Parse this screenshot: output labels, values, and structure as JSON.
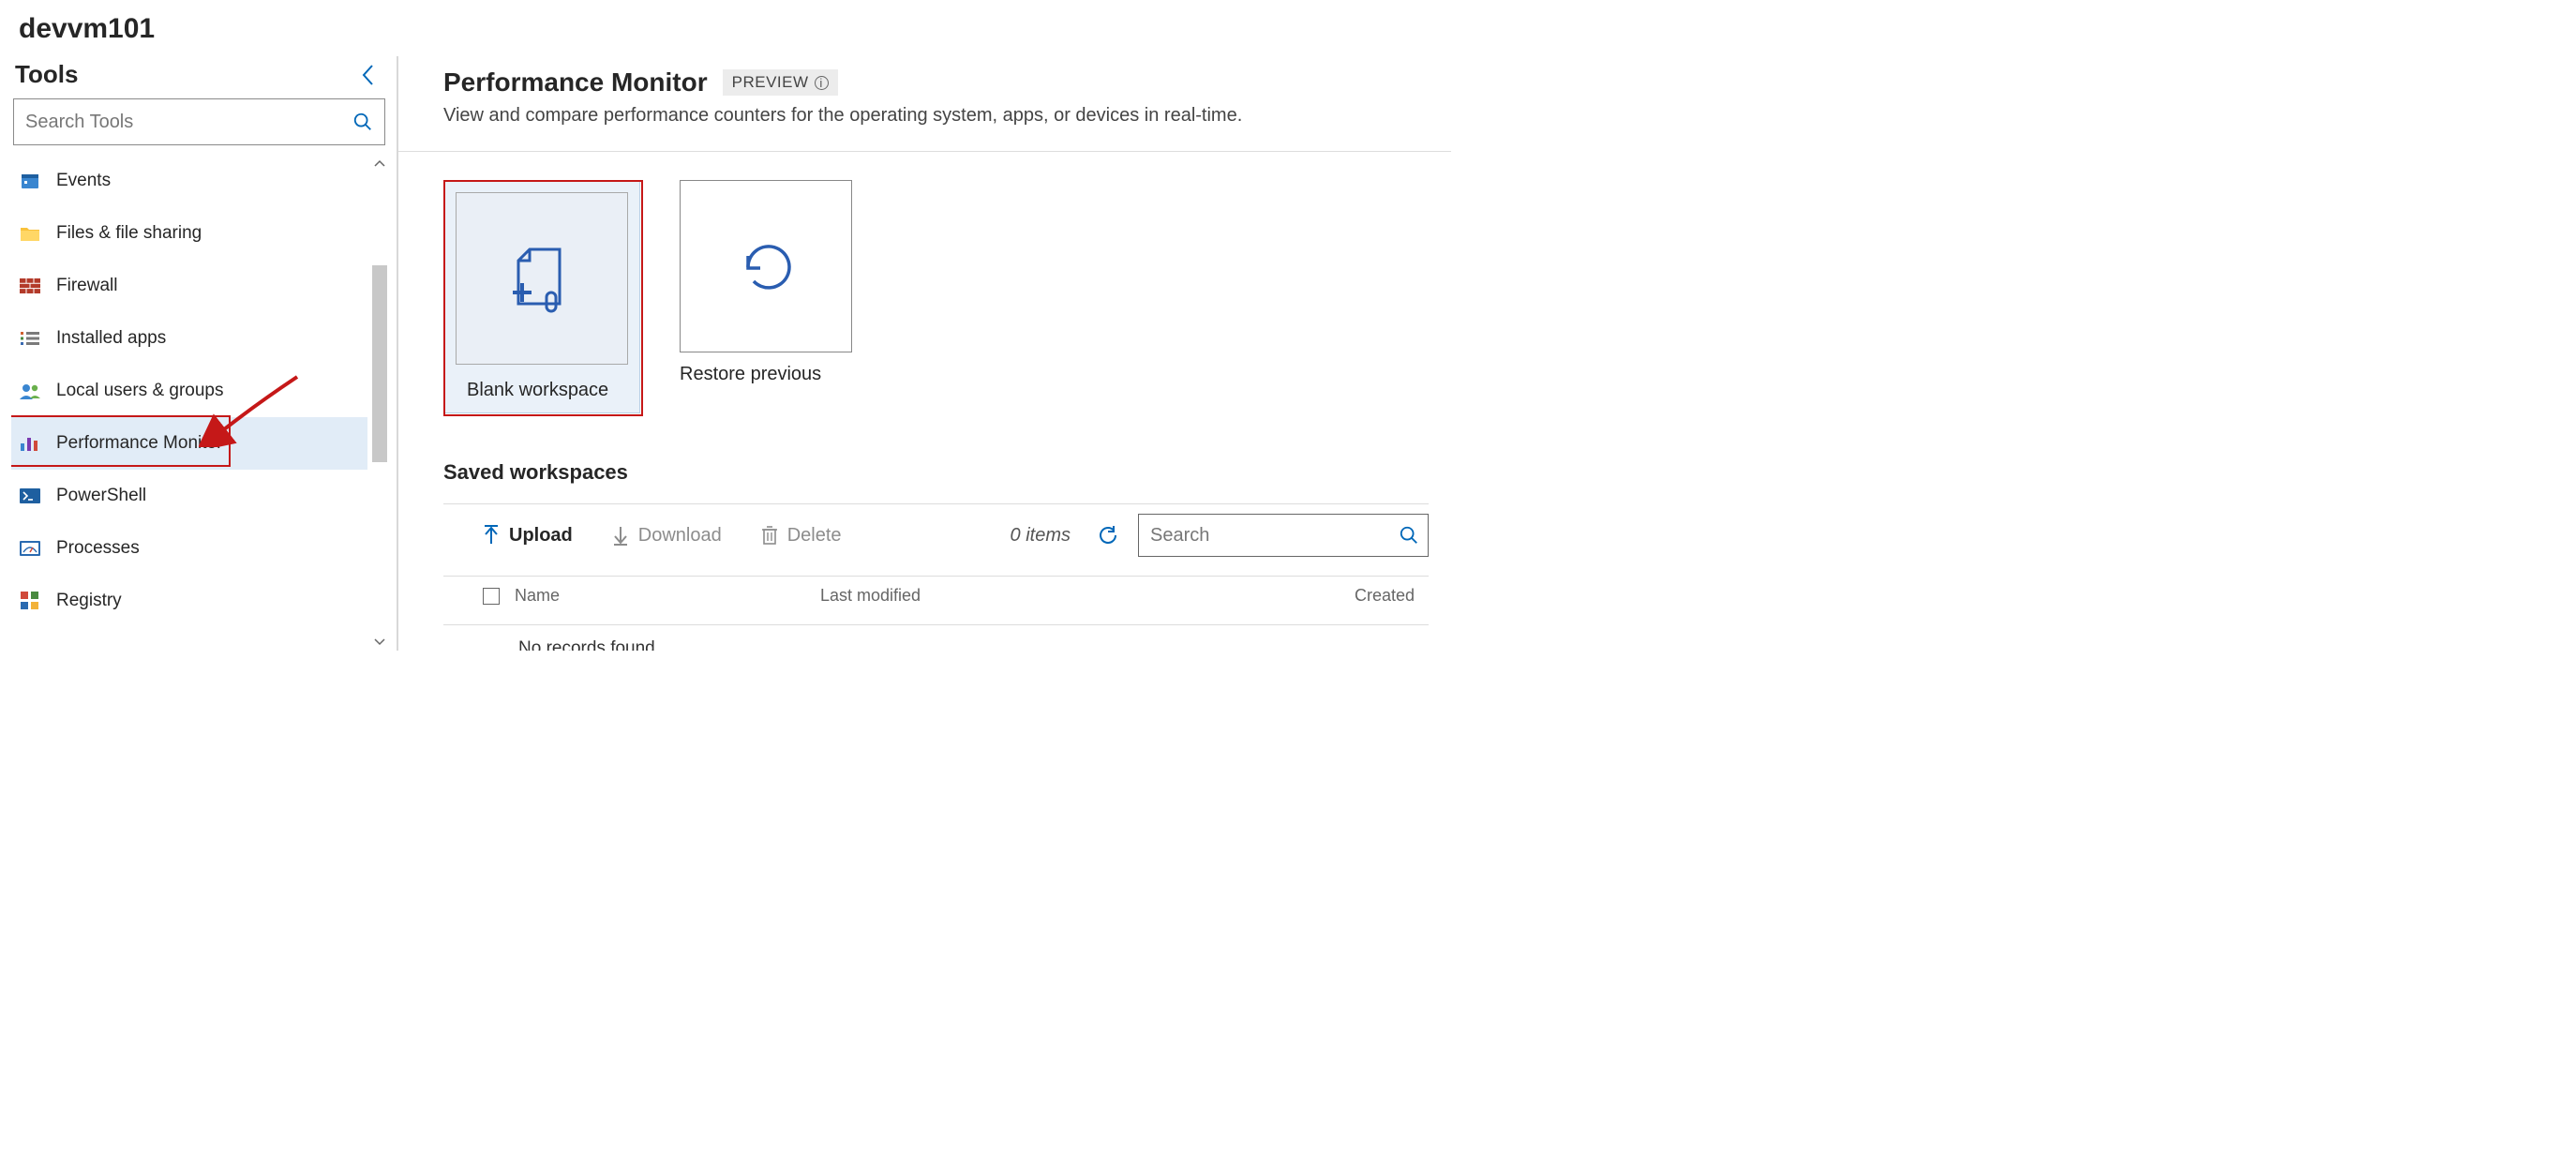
{
  "page_title": "devvm101",
  "sidebar": {
    "heading": "Tools",
    "search_placeholder": "Search Tools",
    "items": [
      {
        "label": "Events"
      },
      {
        "label": "Files & file sharing"
      },
      {
        "label": "Firewall"
      },
      {
        "label": "Installed apps"
      },
      {
        "label": "Local users & groups"
      },
      {
        "label": "Performance Monitor"
      },
      {
        "label": "PowerShell"
      },
      {
        "label": "Processes"
      },
      {
        "label": "Registry"
      }
    ],
    "active_index": 5
  },
  "main": {
    "title": "Performance Monitor",
    "badge": "PREVIEW",
    "subtitle": "View and compare performance counters for the operating system, apps, or devices in real-time.",
    "cards": [
      {
        "label": "Blank workspace"
      },
      {
        "label": "Restore previous"
      }
    ],
    "saved_section_title": "Saved workspaces",
    "toolbar": {
      "upload": "Upload",
      "download": "Download",
      "delete": "Delete",
      "item_count": "0 items",
      "search_placeholder": "Search"
    },
    "table": {
      "col_name": "Name",
      "col_last": "Last modified",
      "col_created": "Created",
      "empty": "No records found"
    }
  },
  "icons": {
    "events": "calendar-icon",
    "files": "folder-icon",
    "firewall": "firewall-icon",
    "installed": "list-icon",
    "users": "users-icon",
    "perf": "chart-icon",
    "powershell": "terminal-icon",
    "processes": "gauge-icon",
    "registry": "grid-icon"
  }
}
